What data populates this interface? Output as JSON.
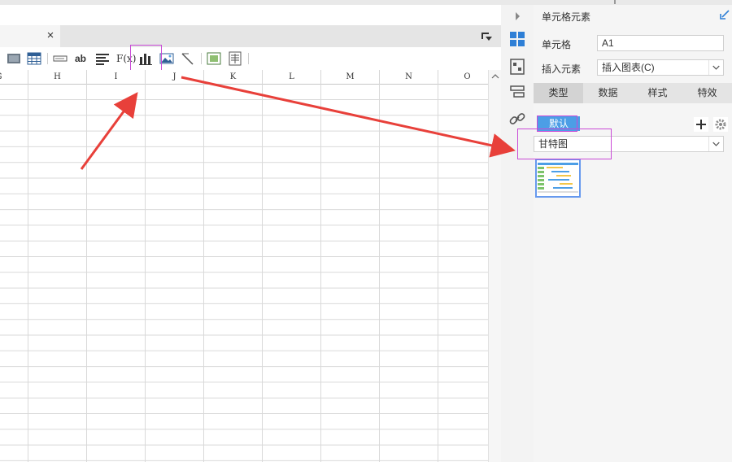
{
  "window": {
    "top_strip": ""
  },
  "tabbar": {
    "close_label": "×"
  },
  "toolbar": {
    "icons": [
      "merge-cell-icon",
      "table-icon",
      "text-field-icon",
      "text-label-icon",
      "align-icon",
      "formula-icon",
      "bar-chart-icon",
      "image-icon",
      "slash-icon",
      "frame-icon",
      "report-icon"
    ],
    "text_label": "ab",
    "formula_label": "F(x)"
  },
  "columns": [
    "G",
    "H",
    "I",
    "J",
    "K",
    "L",
    "M",
    "N",
    "O"
  ],
  "panel": {
    "title": "单元格元素",
    "cell_label": "单元格",
    "cell_value": "A1",
    "insert_label": "插入元素",
    "insert_value": "插入图表(C)",
    "tabs": [
      "类型",
      "数据",
      "样式",
      "特效"
    ],
    "active_tab": "类型",
    "default_label": "默认",
    "chart_type_value": "甘特图"
  },
  "colors": {
    "accent": "#4c9ee6",
    "highlight": "#c94ad6",
    "arrow": "#e8403a"
  }
}
